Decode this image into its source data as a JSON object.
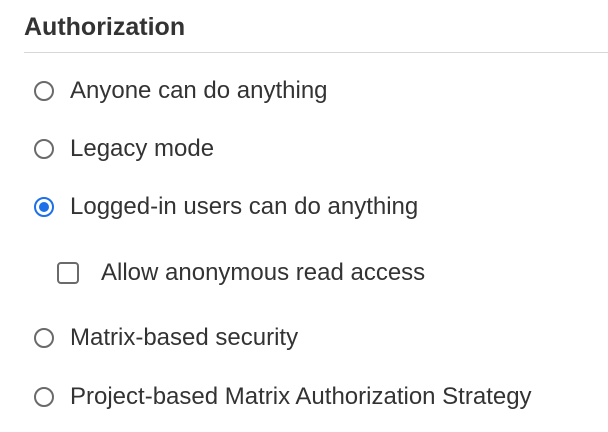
{
  "section": {
    "title": "Authorization"
  },
  "options": [
    {
      "label": "Anyone can do anything",
      "selected": false
    },
    {
      "label": "Legacy mode",
      "selected": false
    },
    {
      "label": "Logged-in users can do anything",
      "selected": true
    },
    {
      "label": "Matrix-based security",
      "selected": false
    },
    {
      "label": "Project-based Matrix Authorization Strategy",
      "selected": false
    }
  ],
  "sub_option": {
    "label": "Allow anonymous read access",
    "checked": false
  },
  "colors": {
    "accent": "#1d70e8",
    "text": "#333333",
    "control_border": "#6a6a6a",
    "divider": "#d7d7d7"
  }
}
